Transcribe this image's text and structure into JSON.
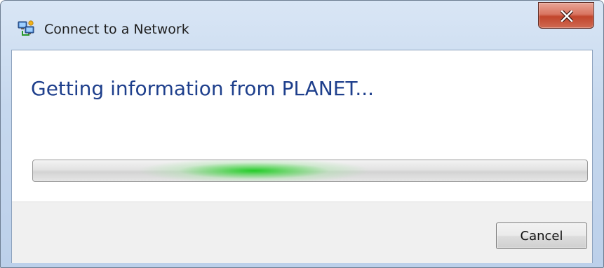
{
  "window": {
    "title": "Connect to a Network",
    "icon": "network-connect-icon",
    "close_icon": "close-icon"
  },
  "content": {
    "heading": "Getting information from PLANET..."
  },
  "progress": {
    "mode": "indeterminate",
    "indicator_color": "#24cc28"
  },
  "buttons": {
    "cancel": "Cancel"
  },
  "colors": {
    "heading": "#1e3f8c",
    "close_button": "#c1452c"
  }
}
